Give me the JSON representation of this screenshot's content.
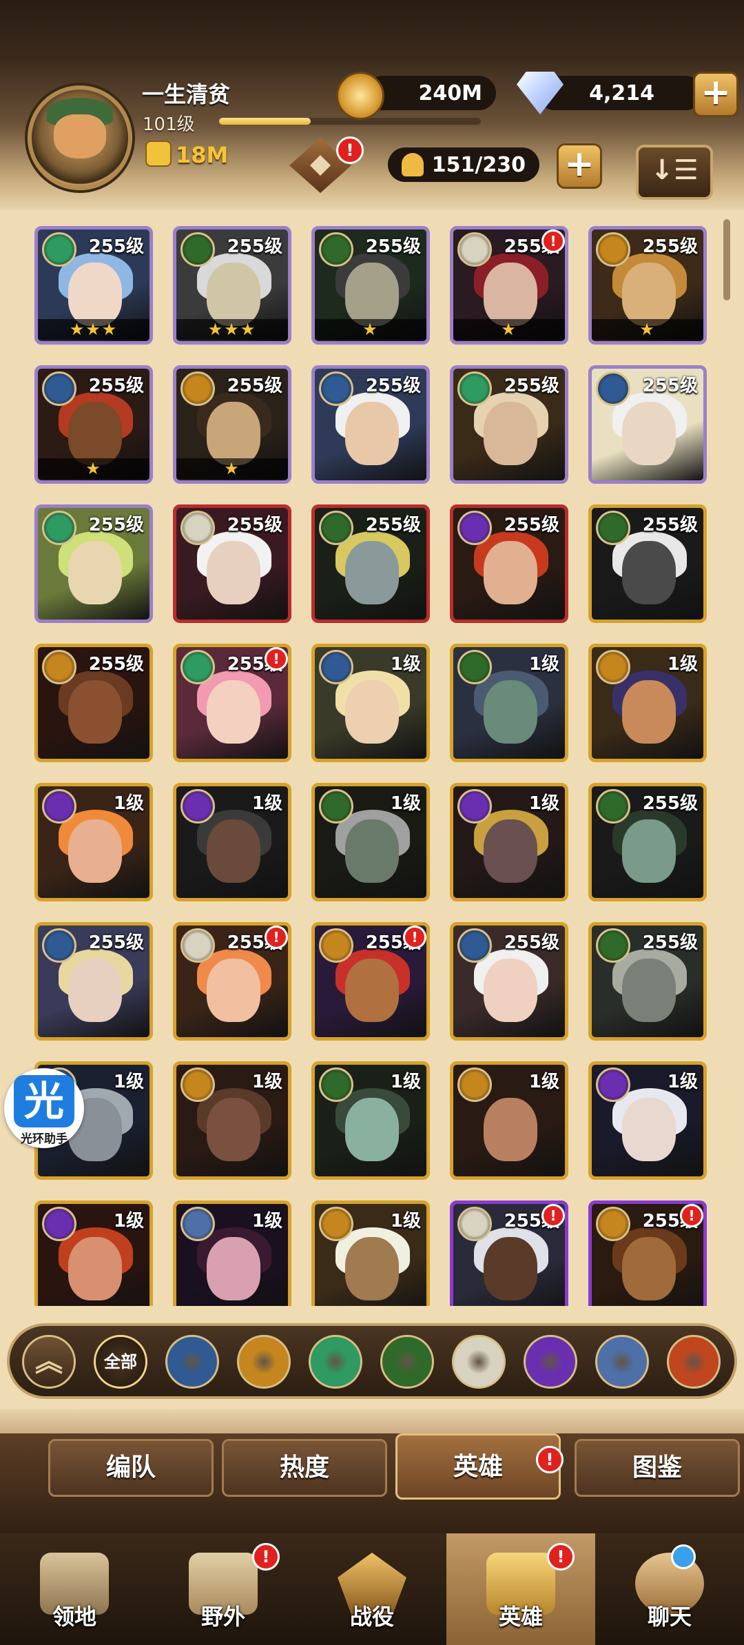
{
  "player": {
    "name": "一生清贫",
    "level": "101级",
    "xp_fraction": 0.35,
    "power": "18M"
  },
  "resources": {
    "gold": "240M",
    "gems": "4,214"
  },
  "roster": {
    "capacity": "151/230",
    "sort_icon": "↓☰"
  },
  "alerts": {
    "mark": "!"
  },
  "colors": {
    "frame_purple": "#9b7fc8",
    "frame_red": "#b92d2a",
    "frame_gold": "#d6a22a",
    "frame_violet": "#8a3bd1"
  },
  "heroes": [
    {
      "level": "255级",
      "stars": "★★★",
      "tier": "purple",
      "faction": "wilder-icon"
    },
    {
      "level": "255级",
      "stars": "★★★",
      "tier": "purple",
      "faction": "graveborn-icon"
    },
    {
      "level": "255级",
      "stars": "★",
      "tier": "purple",
      "faction": "graveborn-icon"
    },
    {
      "level": "255级",
      "stars": "★",
      "tier": "purple",
      "faction": "celestial-icon",
      "alert": true
    },
    {
      "level": "255级",
      "stars": "★",
      "tier": "purple",
      "faction": "mauler-icon"
    },
    {
      "level": "255级",
      "stars": "★",
      "tier": "purple",
      "faction": "lightbearer-icon"
    },
    {
      "level": "255级",
      "stars": "★",
      "tier": "purple",
      "faction": "mauler-icon"
    },
    {
      "level": "255级",
      "stars": "",
      "tier": "purple",
      "faction": "lightbearer-icon"
    },
    {
      "level": "255级",
      "stars": "",
      "tier": "purple",
      "faction": "wilder-icon"
    },
    {
      "level": "255级",
      "stars": "",
      "tier": "purple",
      "faction": "lightbearer-icon"
    },
    {
      "level": "255级",
      "stars": "",
      "tier": "purple",
      "faction": "wilder-icon"
    },
    {
      "level": "255级",
      "stars": "",
      "tier": "red",
      "faction": "celestial-icon"
    },
    {
      "level": "255级",
      "stars": "",
      "tier": "red",
      "faction": "graveborn-icon"
    },
    {
      "level": "255级",
      "stars": "",
      "tier": "red",
      "faction": "hypogean-icon"
    },
    {
      "level": "255级",
      "stars": "",
      "tier": "gold",
      "faction": "graveborn-icon"
    },
    {
      "level": "255级",
      "stars": "",
      "tier": "gold",
      "faction": "mauler-icon"
    },
    {
      "level": "255级",
      "stars": "",
      "tier": "gold",
      "faction": "wilder-icon",
      "alert": true
    },
    {
      "level": "1级",
      "stars": "",
      "tier": "gold",
      "faction": "lightbearer-icon"
    },
    {
      "level": "1级",
      "stars": "",
      "tier": "gold",
      "faction": "graveborn-icon"
    },
    {
      "level": "1级",
      "stars": "",
      "tier": "gold",
      "faction": "mauler-icon"
    },
    {
      "level": "1级",
      "stars": "",
      "tier": "gold",
      "faction": "hypogean-icon"
    },
    {
      "level": "1级",
      "stars": "",
      "tier": "gold",
      "faction": "hypogean-icon"
    },
    {
      "level": "1级",
      "stars": "",
      "tier": "gold",
      "faction": "graveborn-icon"
    },
    {
      "level": "1级",
      "stars": "",
      "tier": "gold",
      "faction": "hypogean-icon"
    },
    {
      "level": "255级",
      "stars": "",
      "tier": "gold",
      "faction": "graveborn-icon"
    },
    {
      "level": "255级",
      "stars": "",
      "tier": "gold",
      "faction": "lightbearer-icon"
    },
    {
      "level": "255级",
      "stars": "",
      "tier": "gold",
      "faction": "celestial-icon",
      "alert": true
    },
    {
      "level": "255级",
      "stars": "",
      "tier": "gold",
      "faction": "mauler-icon",
      "alert": true
    },
    {
      "level": "255级",
      "stars": "",
      "tier": "gold",
      "faction": "lightbearer-icon"
    },
    {
      "level": "255级",
      "stars": "",
      "tier": "gold",
      "faction": "graveborn-icon"
    },
    {
      "level": "1级",
      "stars": "",
      "tier": "gold",
      "faction": "lightbearer-icon"
    },
    {
      "level": "1级",
      "stars": "",
      "tier": "gold",
      "faction": "mauler-icon"
    },
    {
      "level": "1级",
      "stars": "",
      "tier": "gold",
      "faction": "graveborn-icon"
    },
    {
      "level": "1级",
      "stars": "",
      "tier": "gold",
      "faction": "mauler-icon"
    },
    {
      "level": "1级",
      "stars": "",
      "tier": "gold",
      "faction": "hypogean-icon"
    },
    {
      "level": "1级",
      "stars": "",
      "tier": "gold",
      "faction": "hypogean-icon"
    },
    {
      "level": "1级",
      "stars": "",
      "tier": "gold",
      "faction": "dimensional-icon"
    },
    {
      "level": "1级",
      "stars": "",
      "tier": "gold",
      "faction": "mauler-icon"
    },
    {
      "level": "255级",
      "stars": "",
      "tier": "violet",
      "faction": "celestial-icon",
      "alert": true
    },
    {
      "level": "255级",
      "stars": "",
      "tier": "violet",
      "faction": "mauler-icon",
      "alert": true
    }
  ],
  "filter": {
    "all_label": "全部",
    "factions": [
      {
        "name": "lightbearer-icon",
        "color": "#2f5a93"
      },
      {
        "name": "mauler-icon",
        "color": "#c5861e"
      },
      {
        "name": "wilder-icon",
        "color": "#2f9a62"
      },
      {
        "name": "graveborn-icon",
        "color": "#2f6a2a"
      },
      {
        "name": "celestial-icon",
        "color": "#d8d2c0"
      },
      {
        "name": "hypogean-icon",
        "color": "#6a2fb0"
      },
      {
        "name": "dimensional-icon",
        "color": "#4e6fa8"
      },
      {
        "name": "fire-icon",
        "color": "#c0461f"
      }
    ]
  },
  "tabs": [
    "编队",
    "热度",
    "英雄",
    "图鉴"
  ],
  "nav": [
    "领地",
    "野外",
    "战役",
    "英雄",
    "聊天"
  ],
  "overlay": {
    "glyph": "光",
    "label": "光环助手"
  }
}
